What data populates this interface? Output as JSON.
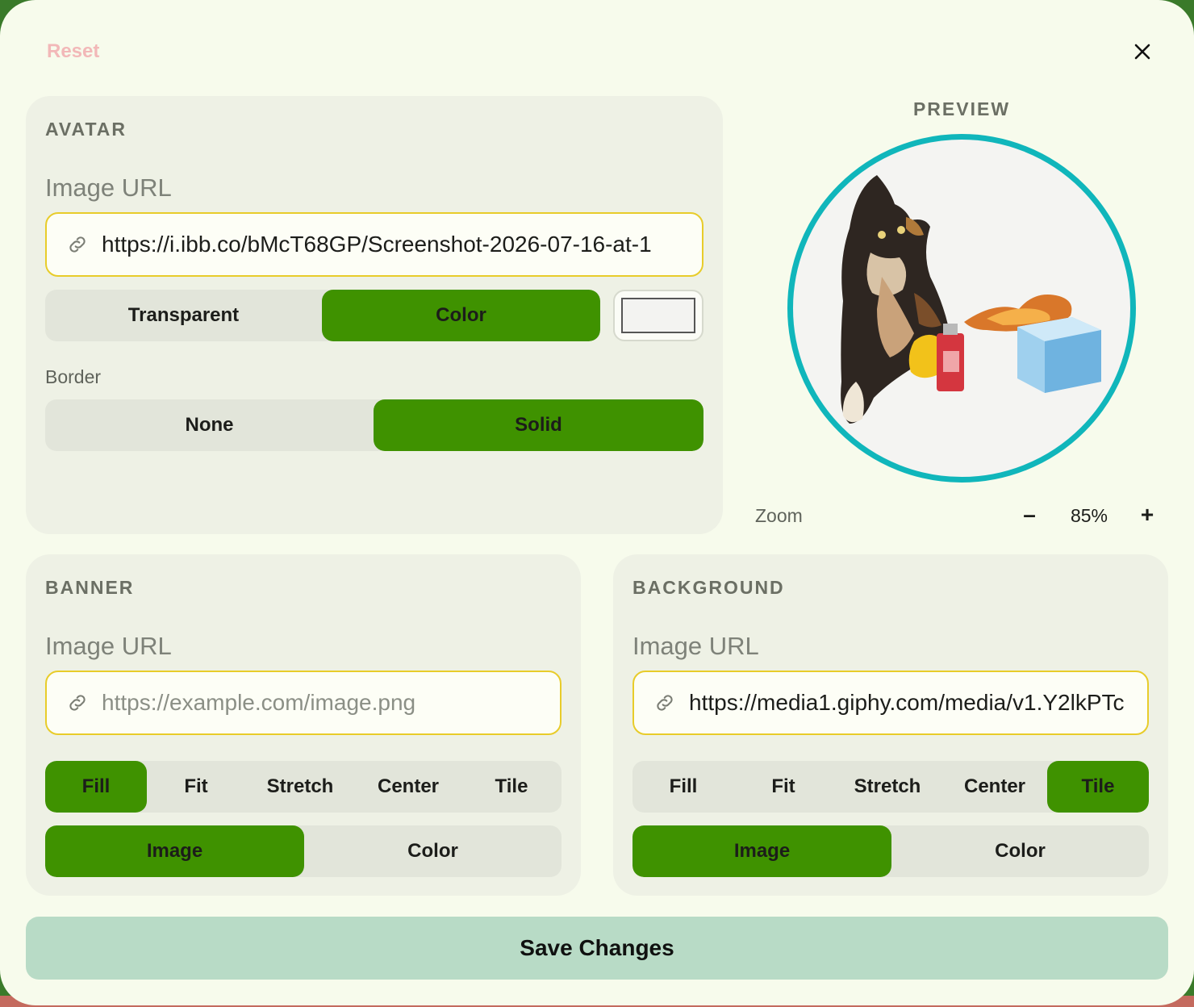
{
  "header": {
    "reset_label": "Reset",
    "close_icon": "close-icon"
  },
  "avatar": {
    "title": "AVATAR",
    "image_url_label": "Image URL",
    "image_url_value": "https://i.ibb.co/bMcT68GP/Screenshot-2026-07-16-at-1",
    "background_options": [
      "Transparent",
      "Color"
    ],
    "background_selected": "Color",
    "color_swatch": "#f3f3f1",
    "border_label": "Border",
    "border_options": [
      "None",
      "Solid"
    ],
    "border_selected": "Solid"
  },
  "preview": {
    "title": "PREVIEW",
    "ring_color": "#10b6bb",
    "zoom_label": "Zoom",
    "zoom_minus": "–",
    "zoom_value": "85%",
    "zoom_plus": "+"
  },
  "banner": {
    "title": "BANNER",
    "image_url_label": "Image URL",
    "image_url_value": "",
    "image_url_placeholder": "https://example.com/image.png",
    "fit_options": [
      "Fill",
      "Fit",
      "Stretch",
      "Center",
      "Tile"
    ],
    "fit_selected": "Fill",
    "source_options": [
      "Image",
      "Color"
    ],
    "source_selected": "Image"
  },
  "background": {
    "title": "BACKGROUND",
    "image_url_label": "Image URL",
    "image_url_value": "https://media1.giphy.com/media/v1.Y2lkPTc",
    "fit_options": [
      "Fill",
      "Fit",
      "Stretch",
      "Center",
      "Tile"
    ],
    "fit_selected": "Tile",
    "source_options": [
      "Image",
      "Color"
    ],
    "source_selected": "Image"
  },
  "footer": {
    "save_label": "Save Changes"
  },
  "colors": {
    "accent_green": "#3f9200",
    "input_border": "#e8cc2a",
    "save_button": "#b8dbc6",
    "panel_bg": "#eef1e5",
    "modal_bg": "#f7fbec"
  }
}
